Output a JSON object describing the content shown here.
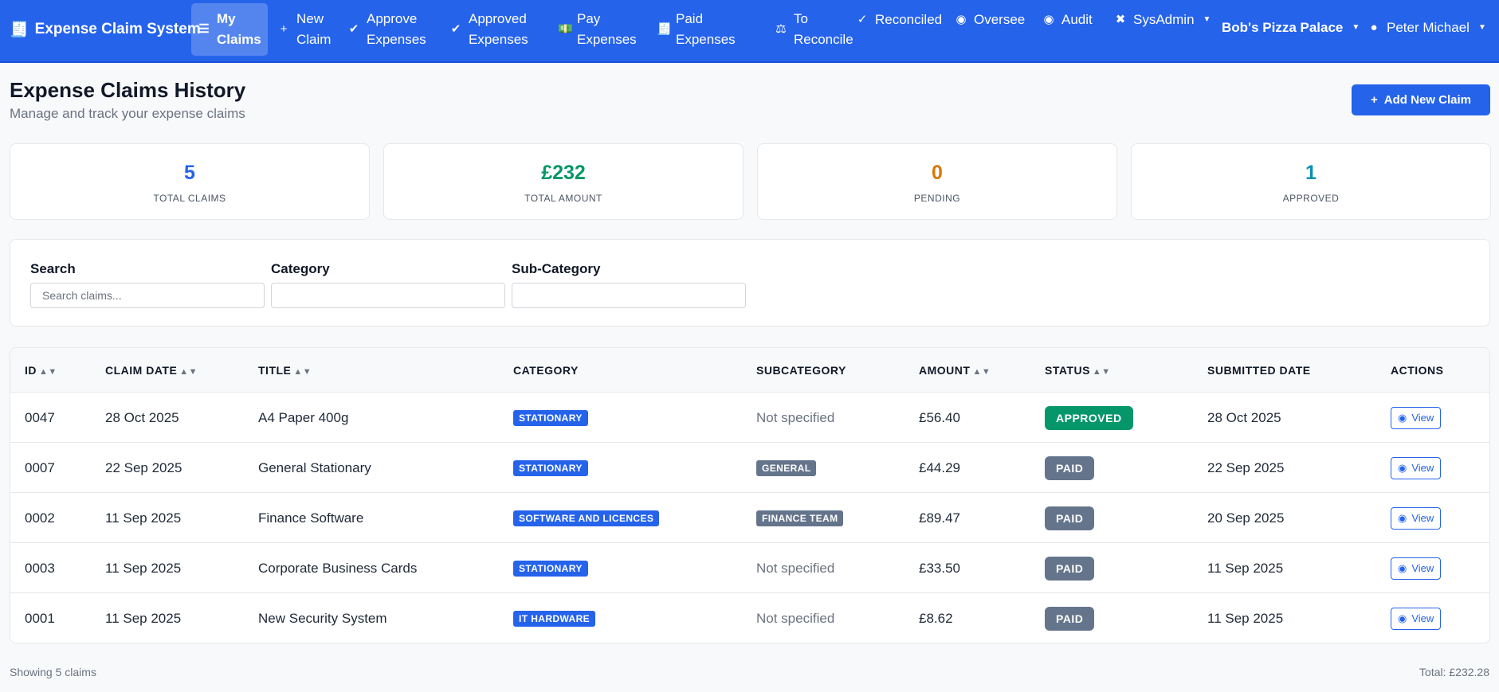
{
  "nav": {
    "brand": "Expense Claim System",
    "items": [
      {
        "icon": "list-icon",
        "glyph": "☰",
        "l1": "My",
        "l2": "Claims",
        "active": true
      },
      {
        "icon": "plus-icon",
        "glyph": "+",
        "l1": "New",
        "l2": "Claim"
      },
      {
        "icon": "check-circle-icon",
        "glyph": "✔",
        "l1": "Approve",
        "l2": "Expenses"
      },
      {
        "icon": "check-circle-icon",
        "glyph": "✔",
        "l1": "Approved",
        "l2": "Expenses"
      },
      {
        "icon": "money-icon",
        "glyph": "💵",
        "l1": "Pay",
        "l2": "Expenses"
      },
      {
        "icon": "invoice-icon",
        "glyph": "🧾",
        "l1": "Paid",
        "l2": "Expenses"
      },
      {
        "icon": "scale-icon",
        "glyph": "⚖",
        "l1": "To",
        "l2": "Reconcile"
      },
      {
        "icon": "double-check-icon",
        "glyph": "✓",
        "l1": "Reconciled"
      },
      {
        "icon": "eye-icon",
        "glyph": "◉",
        "l1": "Oversee"
      },
      {
        "icon": "eye-icon",
        "glyph": "◉",
        "l1": "Audit"
      },
      {
        "icon": "tools-icon",
        "glyph": "✖",
        "l1": "SysAdmin",
        "dropdown": true
      }
    ],
    "company": "Bob's Pizza Palace",
    "user": "Peter Michael"
  },
  "page": {
    "title": "Expense Claims History",
    "subtitle": "Manage and track your expense claims",
    "add_button": "Add New Claim"
  },
  "stats": [
    {
      "value": "5",
      "label": "TOTAL CLAIMS",
      "color": "#2563eb"
    },
    {
      "value": "£232",
      "label": "TOTAL AMOUNT",
      "color": "#059669"
    },
    {
      "value": "0",
      "label": "PENDING",
      "color": "#d97706"
    },
    {
      "value": "1",
      "label": "APPROVED",
      "color": "#0891b2"
    }
  ],
  "filters": {
    "search_label": "Search",
    "search_placeholder": "Search claims...",
    "category_label": "Category",
    "category_value": "",
    "subcategory_label": "Sub-Category",
    "subcategory_value": ""
  },
  "table": {
    "headers": [
      "ID",
      "CLAIM DATE",
      "TITLE",
      "CATEGORY",
      "SUBCATEGORY",
      "AMOUNT",
      "STATUS",
      "SUBMITTED DATE",
      "ACTIONS"
    ],
    "sortable": [
      true,
      true,
      true,
      false,
      false,
      true,
      true,
      false,
      false
    ],
    "view_label": "View",
    "rows": [
      {
        "id": "0047",
        "date": "28 Oct 2025",
        "title": "A4 Paper 400g",
        "category": "STATIONARY",
        "subcategory": "Not specified",
        "amount": "£56.40",
        "status": "APPROVED",
        "submitted": "28 Oct 2025"
      },
      {
        "id": "0007",
        "date": "22 Sep 2025",
        "title": "General Stationary",
        "category": "STATIONARY",
        "subcategory": "GENERAL",
        "amount": "£44.29",
        "status": "PAID",
        "submitted": "22 Sep 2025"
      },
      {
        "id": "0002",
        "date": "11 Sep 2025",
        "title": "Finance Software",
        "category": "SOFTWARE AND LICENCES",
        "subcategory": "FINANCE TEAM",
        "amount": "£89.47",
        "status": "PAID",
        "submitted": "20 Sep 2025"
      },
      {
        "id": "0003",
        "date": "11 Sep 2025",
        "title": "Corporate Business Cards",
        "category": "STATIONARY",
        "subcategory": "Not specified",
        "amount": "£33.50",
        "status": "PAID",
        "submitted": "11 Sep 2025"
      },
      {
        "id": "0001",
        "date": "11 Sep 2025",
        "title": "New Security System",
        "category": "IT HARDWARE",
        "subcategory": "Not specified",
        "amount": "£8.62",
        "status": "PAID",
        "submitted": "11 Sep 2025"
      }
    ]
  },
  "footer": {
    "showing": "Showing 5 claims",
    "total": "Total: £232.28"
  },
  "colors": {
    "primary": "#2563eb",
    "approved": "#059669",
    "paid": "#64748b"
  }
}
